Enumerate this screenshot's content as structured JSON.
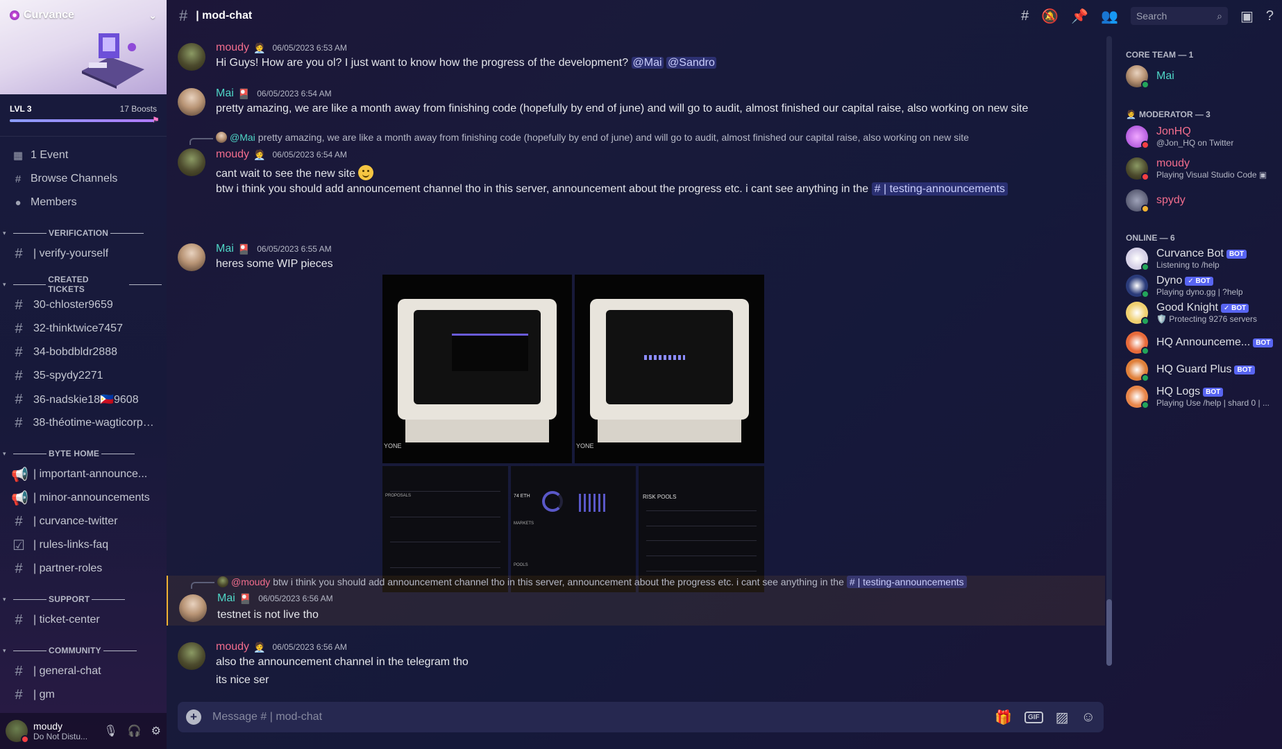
{
  "server": {
    "name": "Curvance",
    "level": "LVL 3",
    "boosts": "17 Boosts",
    "boost_progress": 0.98
  },
  "nav": {
    "events": "1 Event",
    "browse": "Browse Channels",
    "members": "Members"
  },
  "categories": [
    {
      "label": "VERIFICATION",
      "channels": [
        "| verify-yourself"
      ]
    },
    {
      "label": "CREATED TICKETS",
      "channels": [
        "30-chloster9659",
        "32-thinktwice7457",
        "34-bobdbldr2888",
        "35-spydy2271",
        "36-nadskie18🇵🇭9608",
        "38-théotime-wagticorp7..."
      ]
    },
    {
      "label": "BYTE HOME",
      "channels": [
        "| important-announce...",
        "| minor-announcements",
        "| curvance-twitter",
        "| rules-links-faq",
        "| partner-roles"
      ]
    },
    {
      "label": "SUPPORT",
      "channels": [
        "| ticket-center"
      ]
    },
    {
      "label": "COMMUNITY",
      "channels": [
        "| general-chat",
        "| gm"
      ]
    }
  ],
  "user": {
    "name": "moudy",
    "status": "Do Not Distu..."
  },
  "header": {
    "channel": "| mod-chat",
    "search_placeholder": "Search"
  },
  "messages": [
    {
      "author": "moudy",
      "time": "06/05/2023 6:53 AM",
      "text": "Hi Guys! How are you ol? I just want to know how the progress of the development?",
      "mentions": [
        "@Mai",
        "@Sandro"
      ]
    },
    {
      "author": "Mai",
      "time": "06/05/2023 6:54 AM",
      "text": "pretty amazing, we are like a month away from finishing code (hopefully by end of june) and will go to audit, almost finished our capital raise, also working on new site"
    },
    {
      "reply_author": "@Mai",
      "reply_text": "pretty amazing, we are like a month away from finishing code (hopefully by end of june) and will go to audit, almost finished our capital raise, also working on new site",
      "author": "moudy",
      "time": "06/05/2023 6:54 AM",
      "text": "cant wait to see the new site",
      "text2": "btw i think you should add announcement channel tho in this server, announcement about the progress etc. i cant see anything in the",
      "channel_mention": "| testing-announcements"
    },
    {
      "author": "Mai",
      "time": "06/05/2023 6:55 AM",
      "text": "heres some WIP pieces"
    },
    {
      "reply_author": "@moudy",
      "reply_text": "btw i think you should add announcement channel tho in this server, announcement about the progress etc. i cant see anything in the",
      "reply_channel": "| testing-announcements",
      "author": "Mai",
      "time": "06/05/2023 6:56 AM",
      "text": "testnet is not live tho"
    },
    {
      "author": "moudy",
      "time": "06/05/2023 6:56 AM",
      "text": "also the announcement channel in the telegram tho",
      "text2": "its nice ser"
    }
  ],
  "composer": {
    "placeholder": "Message # | mod-chat"
  },
  "members": {
    "core_label": "CORE TEAM — 1",
    "mod_label": "MODERATOR — 3",
    "online_label": "ONLINE — 6",
    "core": [
      {
        "name": "Mai",
        "color": "#4fd6c6"
      }
    ],
    "mods": [
      {
        "name": "JonHQ",
        "sub": "@Jon_HQ on Twitter",
        "color": "#f26d8d"
      },
      {
        "name": "moudy",
        "sub": "Playing Visual Studio Code",
        "color": "#f26d8d"
      },
      {
        "name": "spydy",
        "sub": "",
        "color": "#f26d8d"
      }
    ],
    "online": [
      {
        "name": "Curvance Bot",
        "sub": "Listening to /help",
        "badge": "BOT"
      },
      {
        "name": "Dyno",
        "sub": "Playing dyno.gg | ?help",
        "badge": "✓ BOT"
      },
      {
        "name": "Good Knight",
        "sub": "🛡️ Protecting 9276 servers",
        "badge": "✓ BOT"
      },
      {
        "name": "HQ Announceme...",
        "sub": "",
        "badge": "BOT"
      },
      {
        "name": "HQ Guard Plus",
        "sub": "",
        "badge": "BOT"
      },
      {
        "name": "HQ Logs",
        "sub": "Playing Use /help | shard 0 | ...",
        "badge": "BOT"
      }
    ]
  },
  "image_captions": {
    "left_label": "YONE",
    "right_label": "YONE",
    "eth": "74 ETH",
    "risk": "RISK POOLS",
    "proposals": "PROPOSALS",
    "markets": "MARKETS",
    "pools": "POOLS"
  }
}
